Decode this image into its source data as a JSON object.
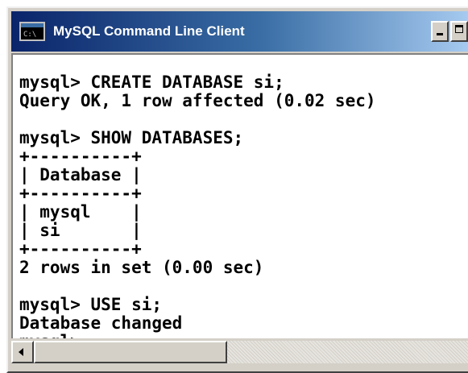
{
  "window": {
    "title": "MySQL Command Line Client",
    "icon": "console-icon",
    "icon_glyph": "C:\\"
  },
  "console": {
    "lines": [
      "",
      "mysql> CREATE DATABASE si;",
      "Query OK, 1 row affected (0.02 sec)",
      "",
      "mysql> SHOW DATABASES;",
      "+----------+",
      "| Database |",
      "+----------+",
      "| mysql    |",
      "| si       |",
      "+----------+",
      "2 rows in set (0.00 sec)",
      "",
      "mysql> USE si;",
      "Database changed",
      "mysql> _"
    ]
  },
  "colors": {
    "titlebar_start": "#0a246a",
    "titlebar_end": "#a6caf0",
    "console_bg": "#ffffff",
    "console_text": "#000000",
    "chrome": "#d4d0c8"
  }
}
